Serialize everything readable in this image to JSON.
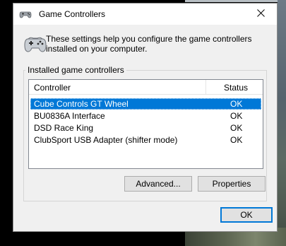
{
  "window": {
    "title": "Game Controllers",
    "icon": "gamepad-icon",
    "close_icon": "close-icon"
  },
  "intro": {
    "icon": "gamepad-icon",
    "text": "These settings help you configure the game controllers installed on your computer."
  },
  "group": {
    "label": "Installed game controllers"
  },
  "listview": {
    "columns": [
      "Controller",
      "Status"
    ],
    "rows": [
      {
        "name": "Cube Controls GT Wheel",
        "status": "OK",
        "selected": true
      },
      {
        "name": "BU0836A Interface",
        "status": "OK",
        "selected": false
      },
      {
        "name": "DSD Race King",
        "status": "OK",
        "selected": false
      },
      {
        "name": "ClubSport USB Adapter (shifter mode)",
        "status": "OK",
        "selected": false
      }
    ]
  },
  "buttons": {
    "advanced": "Advanced...",
    "properties": "Properties",
    "ok": "OK"
  },
  "colors": {
    "selection": "#0078d7",
    "dialog_bg": "#f0f0f0",
    "button_bg": "#e1e1e1"
  }
}
